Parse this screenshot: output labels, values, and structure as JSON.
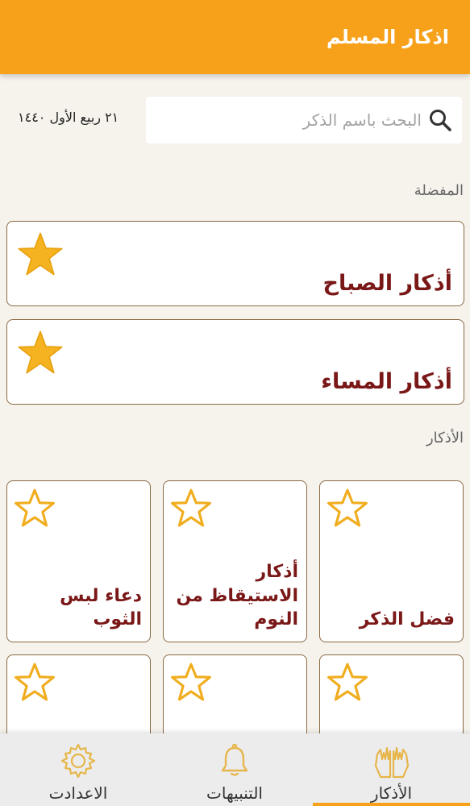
{
  "app": {
    "title": "اذكار المسلم"
  },
  "search": {
    "placeholder": "البحث باسم الذكر",
    "icon": "search-icon"
  },
  "date_text": "٢١ ربيع الأول ١٤٤٠",
  "sections": {
    "favorites": "المفضلة",
    "adhkar": "الأذكار"
  },
  "favorites": [
    {
      "label": "أذكار الصباح",
      "starred": true
    },
    {
      "label": "أذكار المساء",
      "starred": true
    }
  ],
  "tiles": [
    {
      "label": "فضل الذكر",
      "starred": false
    },
    {
      "label": "أذكار الاستيقاظ من النوم",
      "starred": false
    },
    {
      "label": "دعاء لبس الثوب",
      "starred": false
    },
    {
      "label": "",
      "starred": false
    },
    {
      "label": "",
      "starred": false
    },
    {
      "label": "",
      "starred": false
    }
  ],
  "nav": [
    {
      "label": "الأذكار",
      "icon": "praying-hands-icon",
      "active": true
    },
    {
      "label": "التنبيهات",
      "icon": "bell-icon",
      "active": false
    },
    {
      "label": "الاعدادت",
      "icon": "gear-icon",
      "active": false
    }
  ],
  "colors": {
    "accent": "#f7a11b",
    "title_text": "#7a1818",
    "card_border": "#8a6a44",
    "star_fill": "#f5b321"
  }
}
